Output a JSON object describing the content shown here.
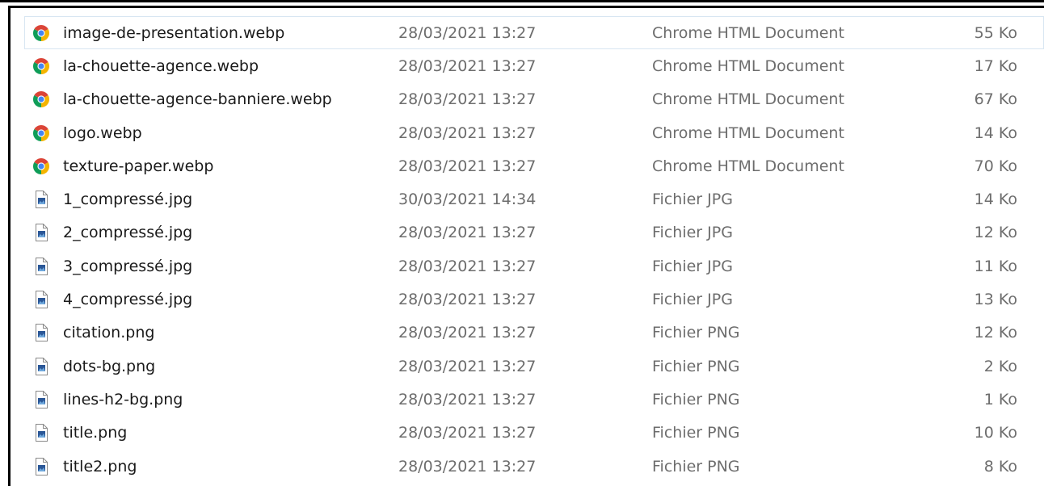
{
  "colors": {
    "chrome_red": "#db4437",
    "chrome_green": "#0f9d58",
    "chrome_yellow": "#f4b400",
    "chrome_blue": "#4285f4",
    "image_file_blue": "#2b5797",
    "selection_border": "#d8e6f2",
    "meta_text": "#6d6d6d"
  },
  "files": [
    {
      "name": "image-de-presentation.webp",
      "date": "28/03/2021 13:27",
      "type": "Chrome HTML Document",
      "size": "55 Ko",
      "icon": "chrome-icon",
      "selected": true
    },
    {
      "name": "la-chouette-agence.webp",
      "date": "28/03/2021 13:27",
      "type": "Chrome HTML Document",
      "size": "17 Ko",
      "icon": "chrome-icon"
    },
    {
      "name": "la-chouette-agence-banniere.webp",
      "date": "28/03/2021 13:27",
      "type": "Chrome HTML Document",
      "size": "67 Ko",
      "icon": "chrome-icon"
    },
    {
      "name": "logo.webp",
      "date": "28/03/2021 13:27",
      "type": "Chrome HTML Document",
      "size": "14 Ko",
      "icon": "chrome-icon"
    },
    {
      "name": "texture-paper.webp",
      "date": "28/03/2021 13:27",
      "type": "Chrome HTML Document",
      "size": "70 Ko",
      "icon": "chrome-icon"
    },
    {
      "name": "1_compressé.jpg",
      "date": "30/03/2021 14:34",
      "type": "Fichier JPG",
      "size": "14 Ko",
      "icon": "image-file-icon"
    },
    {
      "name": "2_compressé.jpg",
      "date": "28/03/2021 13:27",
      "type": "Fichier JPG",
      "size": "12 Ko",
      "icon": "image-file-icon"
    },
    {
      "name": "3_compressé.jpg",
      "date": "28/03/2021 13:27",
      "type": "Fichier JPG",
      "size": "11 Ko",
      "icon": "image-file-icon"
    },
    {
      "name": "4_compressé.jpg",
      "date": "28/03/2021 13:27",
      "type": "Fichier JPG",
      "size": "13 Ko",
      "icon": "image-file-icon"
    },
    {
      "name": "citation.png",
      "date": "28/03/2021 13:27",
      "type": "Fichier PNG",
      "size": "12 Ko",
      "icon": "image-file-icon"
    },
    {
      "name": "dots-bg.png",
      "date": "28/03/2021 13:27",
      "type": "Fichier PNG",
      "size": "2 Ko",
      "icon": "image-file-icon"
    },
    {
      "name": "lines-h2-bg.png",
      "date": "28/03/2021 13:27",
      "type": "Fichier PNG",
      "size": "1 Ko",
      "icon": "image-file-icon"
    },
    {
      "name": "title.png",
      "date": "28/03/2021 13:27",
      "type": "Fichier PNG",
      "size": "10 Ko",
      "icon": "image-file-icon"
    },
    {
      "name": "title2.png",
      "date": "28/03/2021 13:27",
      "type": "Fichier PNG",
      "size": "8 Ko",
      "icon": "image-file-icon"
    }
  ]
}
